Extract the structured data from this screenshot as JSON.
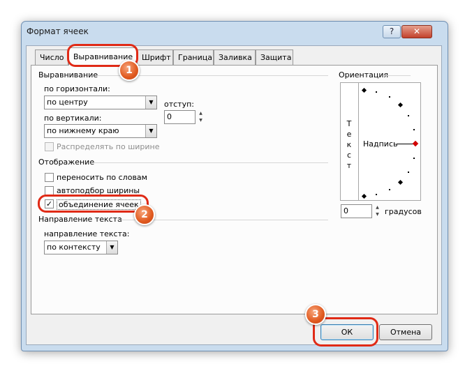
{
  "window": {
    "title": "Формат ячеек",
    "help_label": "?",
    "close_label": "✕"
  },
  "tabs": [
    {
      "label": "Число"
    },
    {
      "label": "Выравнивание",
      "active": true
    },
    {
      "label": "Шрифт"
    },
    {
      "label": "Граница"
    },
    {
      "label": "Заливка"
    },
    {
      "label": "Защита"
    }
  ],
  "alignment": {
    "group_title": "Выравнивание",
    "horizontal_label": "по горизонтали:",
    "horizontal_value": "по центру",
    "indent_label": "отступ:",
    "indent_value": "0",
    "vertical_label": "по вертикали:",
    "vertical_value": "по нижнему краю",
    "distribute_label": "Распределять по ширине"
  },
  "display": {
    "group_title": "Отображение",
    "wrap_label": "переносить по словам",
    "shrink_label": "автоподбор ширины",
    "merge_label": "объединение ячеек",
    "merge_checked": true
  },
  "direction": {
    "group_title": "Направление текста",
    "label": "направление текста:",
    "value": "по контексту"
  },
  "orientation": {
    "group_title": "Ориентация",
    "vertical_text": [
      "Т",
      "е",
      "к",
      "с",
      "т"
    ],
    "caption": "Надпись",
    "degrees_value": "0",
    "degrees_label": "градусов"
  },
  "buttons": {
    "ok": "ОК",
    "cancel": "Отмена"
  },
  "annotations": [
    "1",
    "2",
    "3"
  ],
  "colors": {
    "callout": "#e02a16",
    "badge": "#e0591e"
  }
}
